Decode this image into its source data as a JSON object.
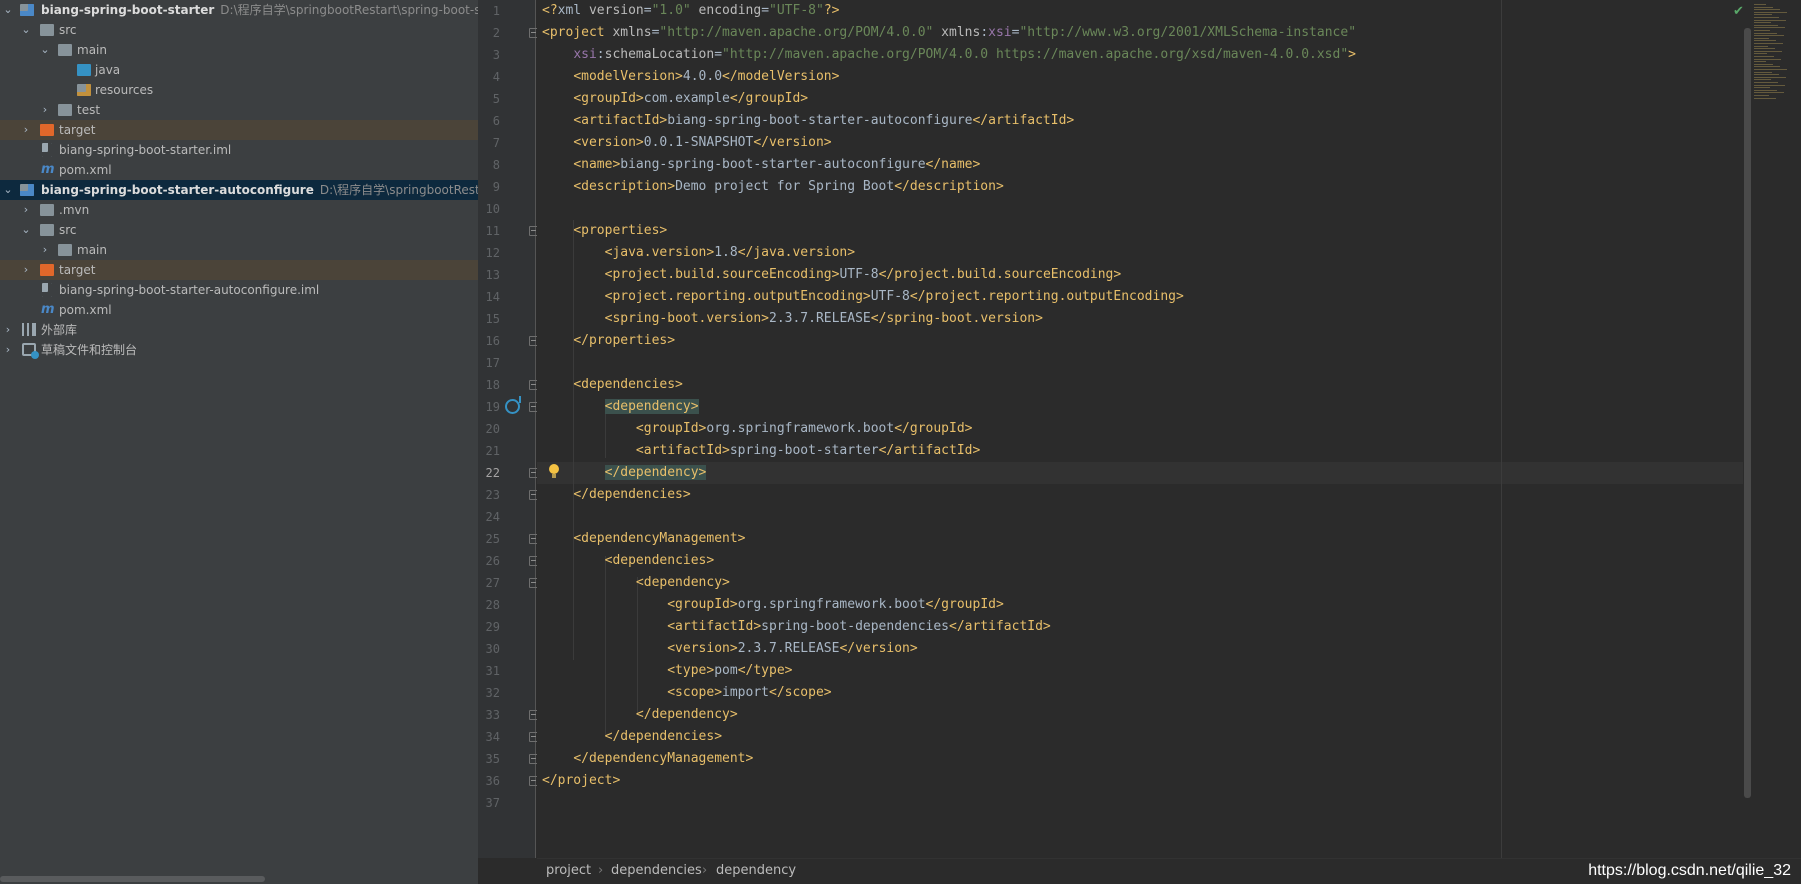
{
  "tree": [
    {
      "label": "biang-spring-boot-starter",
      "path": "D:\\程序自学\\springbootRestart\\spring-boot-sta",
      "bold": true
    },
    {
      "label": "src"
    },
    {
      "label": "main"
    },
    {
      "label": "java"
    },
    {
      "label": "resources"
    },
    {
      "label": "test"
    },
    {
      "label": "target"
    },
    {
      "label": "biang-spring-boot-starter.iml"
    },
    {
      "label": "pom.xml"
    },
    {
      "label": "biang-spring-boot-starter-autoconfigure",
      "path": "D:\\程序自学\\springbootRestart\\",
      "bold": true
    },
    {
      "label": ".mvn"
    },
    {
      "label": "src"
    },
    {
      "label": "main"
    },
    {
      "label": "target"
    },
    {
      "label": "biang-spring-boot-starter-autoconfigure.iml"
    },
    {
      "label": "pom.xml"
    },
    {
      "label": "外部库"
    },
    {
      "label": "草稿文件和控制台"
    }
  ],
  "icons": {
    "expanded": "chevron-down-icon",
    "collapsed": "chevron-right-icon",
    "module": "module-folder-icon",
    "folder": "folder-icon",
    "source": "source-folder-icon",
    "resources": "resources-folder-icon",
    "excluded": "excluded-folder-icon",
    "iml": "iml-file-icon",
    "maven": "maven-file-icon",
    "library": "library-icon",
    "scratch": "scratch-icon"
  },
  "editor": {
    "line_numbers": [
      "1",
      "2",
      "3",
      "4",
      "5",
      "6",
      "7",
      "8",
      "9",
      "10",
      "11",
      "12",
      "13",
      "14",
      "15",
      "16",
      "17",
      "18",
      "19",
      "20",
      "21",
      "22",
      "23",
      "24",
      "25",
      "26",
      "27",
      "28",
      "29",
      "30",
      "31",
      "32",
      "33",
      "34",
      "35",
      "36",
      "37"
    ],
    "current_line": "22",
    "lines": [
      [
        [
          "t-tag",
          "<?"
        ],
        [
          "t-text",
          "xml "
        ],
        [
          "t-attr",
          "version"
        ],
        [
          "t-pun",
          "="
        ],
        [
          "t-val",
          "\"1.0\""
        ],
        [
          "t-attr",
          " encoding"
        ],
        [
          "t-pun",
          "="
        ],
        [
          "t-val",
          "\"UTF-8\""
        ],
        [
          "t-tag",
          "?>"
        ]
      ],
      [
        [
          "t-tag",
          "<project "
        ],
        [
          "t-attr",
          "xmlns"
        ],
        [
          "t-pun",
          "="
        ],
        [
          "t-val",
          "\"http://maven.apache.org/POM/4.0.0\""
        ],
        [
          "t-attr",
          " xmlns"
        ],
        [
          "t-pun",
          ":"
        ],
        [
          "t-ns",
          "xsi"
        ],
        [
          "t-pun",
          "="
        ],
        [
          "t-val",
          "\"http://www.w3.org/2001/XMLSchema-instance\""
        ]
      ],
      [
        [
          "t-text",
          "    "
        ],
        [
          "t-ns",
          "xsi"
        ],
        [
          "t-pun",
          ":"
        ],
        [
          "t-attr",
          "schemaLocation"
        ],
        [
          "t-pun",
          "="
        ],
        [
          "t-val",
          "\"http://maven.apache.org/POM/4.0.0 https://maven.apache.org/xsd/maven-4.0.0.xsd\""
        ],
        [
          "t-tag",
          ">"
        ]
      ],
      [
        [
          "t-text",
          "    "
        ],
        [
          "t-tag",
          "<modelVersion>"
        ],
        [
          "t-text",
          "4.0.0"
        ],
        [
          "t-tag",
          "</modelVersion>"
        ]
      ],
      [
        [
          "t-text",
          "    "
        ],
        [
          "t-tag",
          "<groupId>"
        ],
        [
          "t-text",
          "com.example"
        ],
        [
          "t-tag",
          "</groupId>"
        ]
      ],
      [
        [
          "t-text",
          "    "
        ],
        [
          "t-tag",
          "<artifactId>"
        ],
        [
          "t-text",
          "biang-spring-boot-starter-autoconfigure"
        ],
        [
          "t-tag",
          "</artifactId>"
        ]
      ],
      [
        [
          "t-text",
          "    "
        ],
        [
          "t-tag",
          "<version>"
        ],
        [
          "t-text",
          "0.0.1-SNAPSHOT"
        ],
        [
          "t-tag",
          "</version>"
        ]
      ],
      [
        [
          "t-text",
          "    "
        ],
        [
          "t-tag",
          "<name>"
        ],
        [
          "t-text",
          "biang-spring-boot-starter-autoconfigure"
        ],
        [
          "t-tag",
          "</name>"
        ]
      ],
      [
        [
          "t-text",
          "    "
        ],
        [
          "t-tag",
          "<description>"
        ],
        [
          "t-text",
          "Demo project for Spring Boot"
        ],
        [
          "t-tag",
          "</description>"
        ]
      ],
      [],
      [
        [
          "t-text",
          "    "
        ],
        [
          "t-tag",
          "<properties>"
        ]
      ],
      [
        [
          "t-text",
          "        "
        ],
        [
          "t-tag",
          "<java.version>"
        ],
        [
          "t-text",
          "1.8"
        ],
        [
          "t-tag",
          "</java.version>"
        ]
      ],
      [
        [
          "t-text",
          "        "
        ],
        [
          "t-tag",
          "<project.build.sourceEncoding>"
        ],
        [
          "t-text",
          "UTF-8"
        ],
        [
          "t-tag",
          "</project.build.sourceEncoding>"
        ]
      ],
      [
        [
          "t-text",
          "        "
        ],
        [
          "t-tag",
          "<project.reporting.outputEncoding>"
        ],
        [
          "t-text",
          "UTF-8"
        ],
        [
          "t-tag",
          "</project.reporting.outputEncoding>"
        ]
      ],
      [
        [
          "t-text",
          "        "
        ],
        [
          "t-tag",
          "<spring-boot.version>"
        ],
        [
          "t-text",
          "2.3.7.RELEASE"
        ],
        [
          "t-tag",
          "</spring-boot.version>"
        ]
      ],
      [
        [
          "t-text",
          "    "
        ],
        [
          "t-tag",
          "</properties>"
        ]
      ],
      [],
      [
        [
          "t-text",
          "    "
        ],
        [
          "t-tag",
          "<dependencies>"
        ]
      ],
      [
        [
          "t-text",
          "        "
        ],
        [
          "t-tagb",
          "<dependency>"
        ]
      ],
      [
        [
          "t-text",
          "            "
        ],
        [
          "t-tag",
          "<groupId>"
        ],
        [
          "t-text",
          "org.springframework.boot"
        ],
        [
          "t-tag",
          "</groupId>"
        ]
      ],
      [
        [
          "t-text",
          "            "
        ],
        [
          "t-tag",
          "<artifactId>"
        ],
        [
          "t-text",
          "spring-boot-starter"
        ],
        [
          "t-tag",
          "</artifactId>"
        ]
      ],
      [
        [
          "t-text",
          "        "
        ],
        [
          "t-tagb",
          "</dependency>"
        ]
      ],
      [
        [
          "t-text",
          "    "
        ],
        [
          "t-tag",
          "</dependencies>"
        ]
      ],
      [],
      [
        [
          "t-text",
          "    "
        ],
        [
          "t-tag",
          "<dependencyManagement>"
        ]
      ],
      [
        [
          "t-text",
          "        "
        ],
        [
          "t-tag",
          "<dependencies>"
        ]
      ],
      [
        [
          "t-text",
          "            "
        ],
        [
          "t-tag",
          "<dependency>"
        ]
      ],
      [
        [
          "t-text",
          "                "
        ],
        [
          "t-tag",
          "<groupId>"
        ],
        [
          "t-text",
          "org.springframework.boot"
        ],
        [
          "t-tag",
          "</groupId>"
        ]
      ],
      [
        [
          "t-text",
          "                "
        ],
        [
          "t-tag",
          "<artifactId>"
        ],
        [
          "t-text",
          "spring-boot-dependencies"
        ],
        [
          "t-tag",
          "</artifactId>"
        ]
      ],
      [
        [
          "t-text",
          "                "
        ],
        [
          "t-tag",
          "<version>"
        ],
        [
          "t-text",
          "2.3.7.RELEASE"
        ],
        [
          "t-tag",
          "</version>"
        ]
      ],
      [
        [
          "t-text",
          "                "
        ],
        [
          "t-tag",
          "<type>"
        ],
        [
          "t-text",
          "pom"
        ],
        [
          "t-tag",
          "</type>"
        ]
      ],
      [
        [
          "t-text",
          "                "
        ],
        [
          "t-tag",
          "<scope>"
        ],
        [
          "t-text",
          "import"
        ],
        [
          "t-tag",
          "</scope>"
        ]
      ],
      [
        [
          "t-text",
          "            "
        ],
        [
          "t-tag",
          "</dependency>"
        ]
      ],
      [
        [
          "t-text",
          "        "
        ],
        [
          "t-tag",
          "</dependencies>"
        ]
      ],
      [
        [
          "t-text",
          "    "
        ],
        [
          "t-tag",
          "</dependencyManagement>"
        ]
      ],
      [
        [
          "t-tag",
          "</project>"
        ]
      ],
      []
    ]
  },
  "breadcrumb": [
    "project",
    "dependencies",
    "dependency"
  ],
  "watermark": "https://blog.csdn.net/qilie_32",
  "colors": {
    "tag": "#e8bf6a",
    "value": "#6a8759",
    "text": "#a9b7c6",
    "namespace": "#9876aa",
    "sidebar": "#3c3f41",
    "editor": "#2b2b2b"
  }
}
